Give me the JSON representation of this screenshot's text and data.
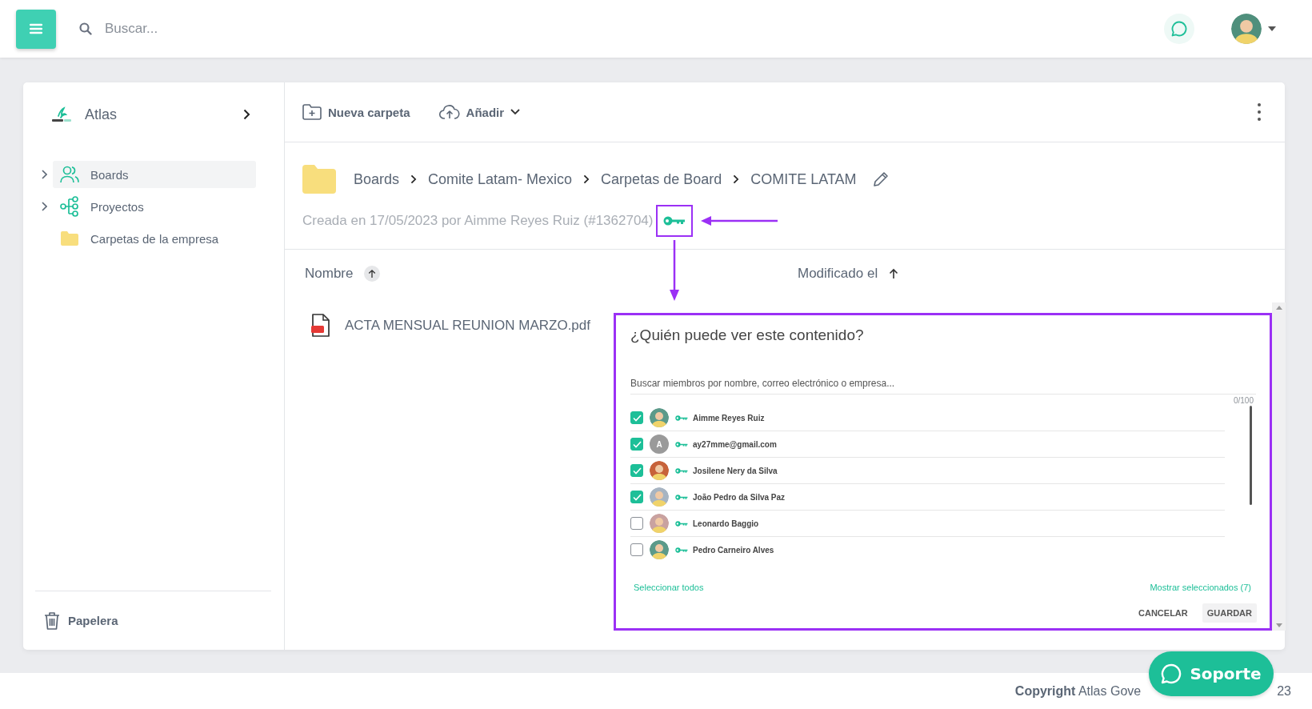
{
  "topbar": {
    "search": {
      "placeholder": "Buscar..."
    }
  },
  "sidebar": {
    "workspace": "Atlas",
    "items": [
      {
        "label": "Boards",
        "kind": "people",
        "expandable": true,
        "selected": true
      },
      {
        "label": "Proyectos",
        "kind": "tree",
        "expandable": true,
        "selected": false
      },
      {
        "label": "Carpetas de la empresa",
        "kind": "folder",
        "expandable": false,
        "selected": false
      }
    ],
    "trash": "Papelera"
  },
  "toolbar": {
    "actions": [
      {
        "label": "Nueva carpeta",
        "kind": "new-folder"
      },
      {
        "label": "Añadir",
        "kind": "upload"
      }
    ]
  },
  "breadcrumb": [
    "Boards",
    "Comite Latam- Mexico",
    "Carpetas de Board",
    "COMITE LATAM"
  ],
  "created_info": "Creada en 17/05/2023 por Aimme Reyes Ruiz (#1362704)",
  "table": {
    "columns": [
      {
        "label": "Nombre",
        "sort_badge": true
      },
      {
        "label": "Modificado el",
        "sort_badge": false
      }
    ],
    "rows": [
      {
        "name": "ACTA MENSUAL REUNION MARZO.pdf"
      }
    ]
  },
  "share_dialog": {
    "title": "¿Quién puede ver este contenido?",
    "search": {
      "placeholder": "Buscar miembros por nombre, correo electrónico o empresa..."
    },
    "counter": "0/100",
    "members": [
      {
        "name": "Aimme Reyes Ruiz",
        "kind": "photo",
        "checked": true
      },
      {
        "name": "ay27mme@gmail.com",
        "kind": "initial",
        "initial": "A",
        "checked": true
      },
      {
        "name": "Josilene Nery da Silva",
        "kind": "photo",
        "checked": true
      },
      {
        "name": "João Pedro da Silva Paz",
        "kind": "photo",
        "checked": true
      },
      {
        "name": "Leonardo Baggio",
        "kind": "photo",
        "checked": false
      },
      {
        "name": "Pedro Carneiro Alves",
        "kind": "photo",
        "checked": false
      }
    ],
    "select_all": "Seleccionar todos",
    "show_selected": "Mostrar seleccionados (7)",
    "buttons": [
      {
        "label": "CANCELAR",
        "selected": false
      },
      {
        "label": "GUARDAR",
        "selected": true
      }
    ]
  },
  "support_button": "Soporte",
  "footer": {
    "copyright": "**Copyright** Atlas Gove",
    "tail": "23"
  }
}
